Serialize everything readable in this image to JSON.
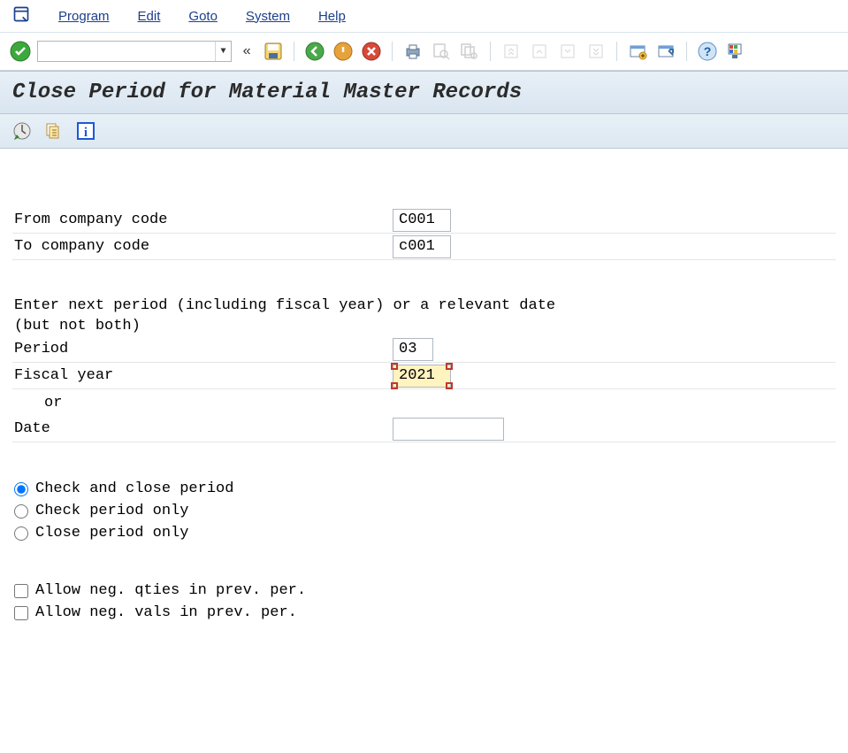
{
  "menu": {
    "program": "Program",
    "edit": "Edit",
    "goto": "Goto",
    "system": "System",
    "help": "Help"
  },
  "command_value": "",
  "page_title": "Close Period for Material Master Records",
  "labels": {
    "from_cc": "From company code",
    "to_cc": "To company code",
    "instr1": "Enter next period (including fiscal year) or a relevant date",
    "instr2": "(but not both)",
    "period": "Period",
    "fiscal_year": "Fiscal year",
    "or": "or",
    "date": "Date"
  },
  "values": {
    "from_cc": "C001",
    "to_cc": "c001",
    "period": "03",
    "fiscal_year": "2021",
    "date": ""
  },
  "radios": {
    "check_close": "Check and close period",
    "check_only": "Check period only",
    "close_only": "Close period only"
  },
  "checks": {
    "neg_qty": "Allow neg. qties in prev. per.",
    "neg_val": "Allow neg. vals in prev. per."
  }
}
